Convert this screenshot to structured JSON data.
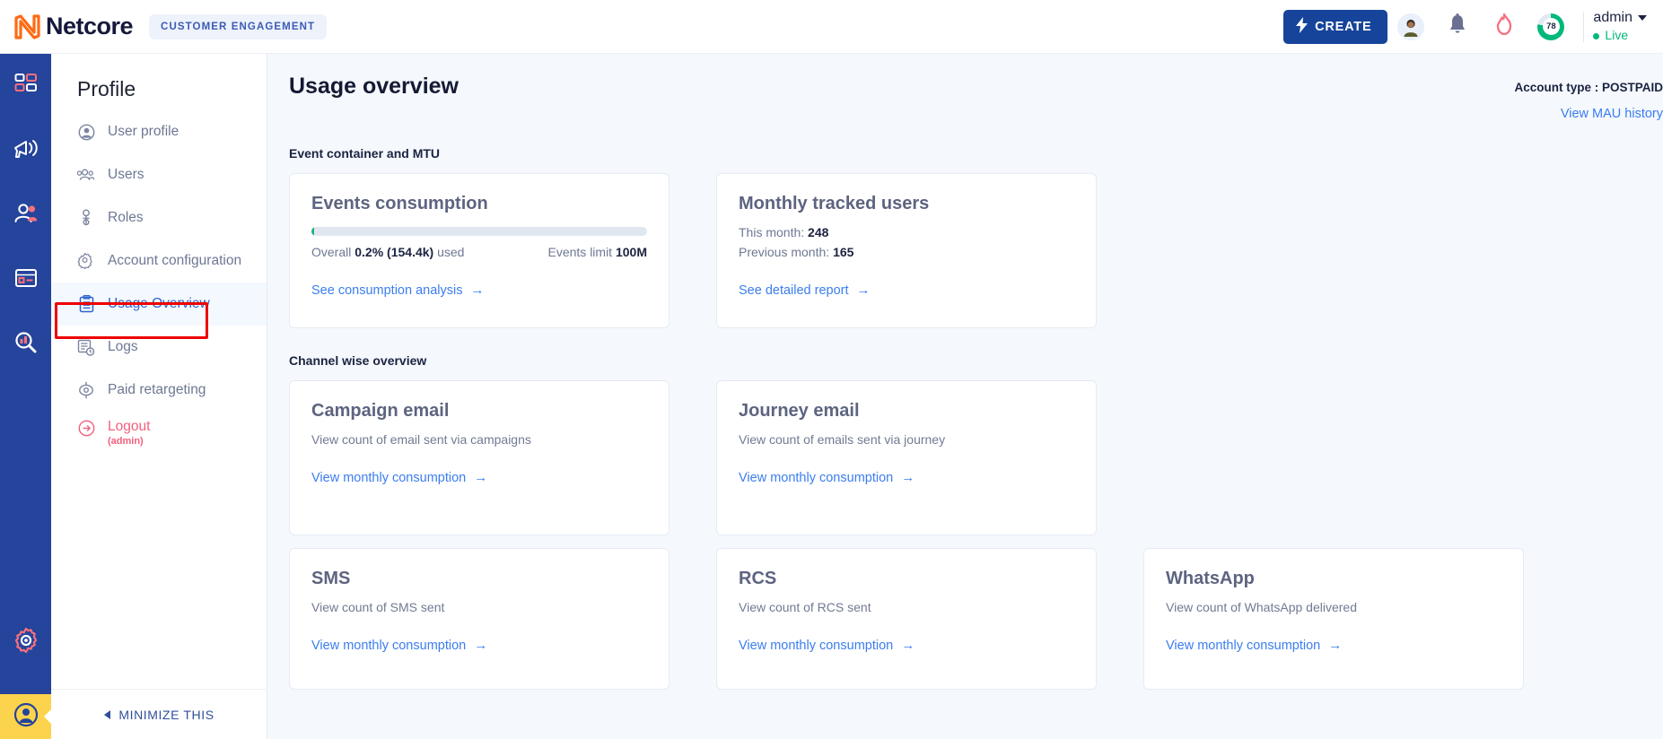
{
  "topbar": {
    "logo_text": "Netcore",
    "logo_icon": "netcore-logo-icon",
    "brand_pill": "CUSTOMER ENGAGEMENT",
    "create_label": "CREATE",
    "create_icon": "lightning-bolt-icon",
    "avatar_icon": "user-avatar-icon",
    "bell_icon": "notification-bell-icon",
    "flame_icon": "flame-icon",
    "score_value": "78",
    "score_percent": 78,
    "user_name": "admin",
    "status_text": "Live",
    "accent_blue": "#16449b",
    "accent_green": "#00b87c"
  },
  "rail": {
    "items": [
      {
        "icon": "dashboard-grid-icon"
      },
      {
        "icon": "megaphone-campaign-icon"
      },
      {
        "icon": "users-audience-icon"
      },
      {
        "icon": "browser-window-icon"
      },
      {
        "icon": "analytics-search-icon"
      }
    ],
    "settings_icon": "settings-gear-icon",
    "profile_icon": "profile-user-icon"
  },
  "sidebar": {
    "title": "Profile",
    "items": [
      {
        "label": "User profile",
        "icon": "user-circle-icon",
        "active": false
      },
      {
        "label": "Users",
        "icon": "users-group-icon",
        "active": false
      },
      {
        "label": "Roles",
        "icon": "roles-key-icon",
        "active": false
      },
      {
        "label": "Account configuration",
        "icon": "gear-users-icon",
        "active": false
      },
      {
        "label": "Usage Overview",
        "icon": "clipboard-list-icon",
        "active": true
      },
      {
        "label": "Logs",
        "icon": "logs-clock-icon",
        "active": false
      },
      {
        "label": "Paid retargeting",
        "icon": "retargeting-icon",
        "active": false
      }
    ],
    "logout": {
      "label": "Logout",
      "sub": "(admin)",
      "icon": "logout-arrow-icon",
      "color": "#f2607c"
    },
    "minimize_label": "MINIMIZE THIS",
    "minimize_icon": "chevron-left-icon",
    "highlight_color": "#ee0000"
  },
  "main": {
    "page_title": "Usage overview",
    "account_type_label": "Account type :",
    "account_type_value": "POSTPAID",
    "mau_history_link": "View MAU history",
    "section_one_label": "Event container and MTU",
    "section_two_label": "Channel wise overview",
    "events_card": {
      "title": "Events consumption",
      "progress_percent": 0.2,
      "usage_prefix": "Overall",
      "usage_value": "0.2% (154.4k)",
      "usage_suffix": "used",
      "limit_label": "Events limit",
      "limit_value": "100M",
      "link": "See consumption analysis",
      "link_icon": "arrow-right-icon"
    },
    "mtu_card": {
      "title": "Monthly tracked users",
      "this_month_label": "This month:",
      "this_month_value": "248",
      "prev_month_label": "Previous month:",
      "prev_month_value": "165",
      "link": "See detailed report",
      "link_icon": "arrow-right-icon"
    },
    "channel_cards": [
      {
        "title": "Campaign email",
        "desc": "View count of email sent via campaigns",
        "link": "View monthly consumption",
        "link_icon": "arrow-right-icon"
      },
      {
        "title": "Journey email",
        "desc": "View count of emails sent via journey",
        "link": "View monthly consumption",
        "link_icon": "arrow-right-icon"
      },
      {
        "title": "SMS",
        "desc": "View count of SMS sent",
        "link": "View monthly consumption",
        "link_icon": "arrow-right-icon"
      },
      {
        "title": "RCS",
        "desc": "View count of RCS sent",
        "link": "View monthly consumption",
        "link_icon": "arrow-right-icon"
      },
      {
        "title": "WhatsApp",
        "desc": "View count of WhatsApp delivered",
        "link": "View monthly consumption",
        "link_icon": "arrow-right-icon"
      }
    ]
  }
}
